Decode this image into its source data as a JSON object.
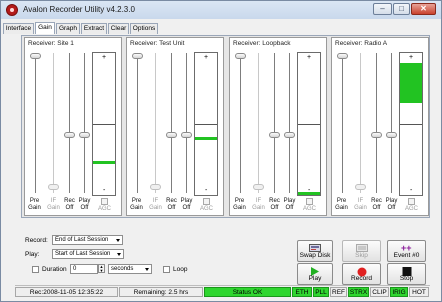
{
  "window": {
    "title": "Avalon Recorder Utility v4.2.3.0",
    "controls": {
      "minimize": "–",
      "maximize": "□",
      "close": "✕"
    }
  },
  "tabs": [
    {
      "label": "Interface",
      "active": false
    },
    {
      "label": "Gain",
      "active": true
    },
    {
      "label": "Graph",
      "active": false
    },
    {
      "label": "Extract",
      "active": false
    },
    {
      "label": "Clear",
      "active": false
    },
    {
      "label": "Options",
      "active": false
    }
  ],
  "receivers": [
    {
      "title": "Receiver: Site 1",
      "meter_level": 0.24
    },
    {
      "title": "Receiver: Test Unit",
      "meter_level": 0.41
    },
    {
      "title": "Receiver: Loopback",
      "meter_level": 0.02
    },
    {
      "title": "Receiver: Radio A",
      "meter_level_range": [
        0.65,
        0.93
      ]
    }
  ],
  "meter_labels": {
    "plus": "+",
    "minus": "-"
  },
  "slider_labels": {
    "pre_gain": [
      "Pre",
      "Gain"
    ],
    "if_gain": [
      "IF",
      "Gain"
    ],
    "rec_off": [
      "Rec",
      "Off"
    ],
    "play_off": [
      "Play",
      "Off"
    ],
    "agc": "AGC"
  },
  "controls": {
    "record_label": "Record:",
    "record_value": "End of Last Session",
    "play_label": "Play:",
    "play_value": "Start of Last Session",
    "duration_label": "Duration",
    "duration_value": "0",
    "duration_unit": "seconds",
    "loop_label": "Loop"
  },
  "buttons": {
    "swap_disk": "Swap Disk",
    "skip": "Skip",
    "event": "Event #0",
    "play": "Play",
    "record": "Record",
    "stop": "Stop"
  },
  "statusbar": {
    "rec": "Rec:2008-11-05 12:35:22",
    "remaining": "Remaining: 2.5 hrs",
    "status": "Status OK",
    "indicators": [
      "ETH",
      "PLL",
      "REF",
      "STRX",
      "CLIP",
      "IRIG",
      "HOT"
    ]
  },
  "colors": {
    "meter_green": "#22c322",
    "status_green": "#2fd62f",
    "record_red": "#e02020",
    "event_purple": "#8a1a9a"
  }
}
